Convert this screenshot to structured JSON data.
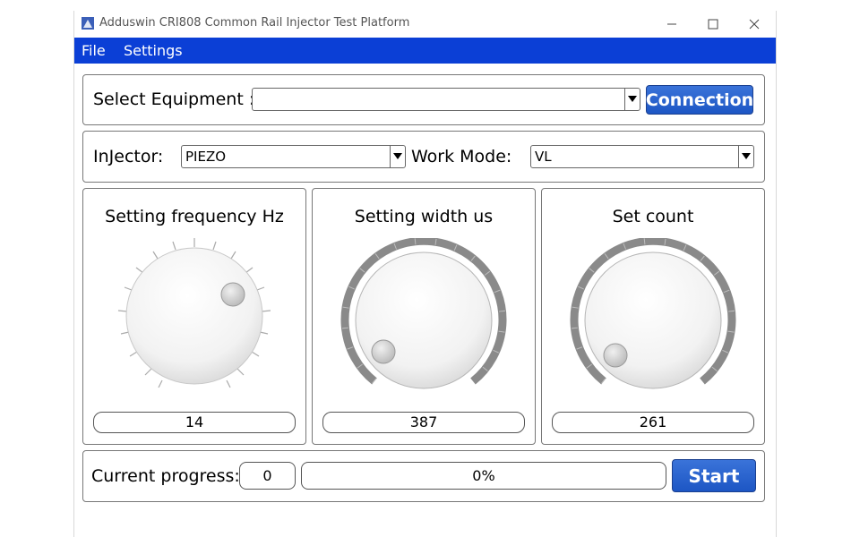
{
  "window": {
    "title": "Adduswin CRI808 Common Rail Injector Test Platform",
    "minimize_icon": "minimize-icon",
    "maximize_icon": "maximize-icon",
    "close_icon": "close-icon"
  },
  "menu": {
    "items": [
      {
        "label": "File"
      },
      {
        "label": "Settings"
      }
    ],
    "bg_color": "#0b3fd6"
  },
  "equipment": {
    "label": "Select Equipment :",
    "value": "",
    "connect_label": "Connection"
  },
  "injector": {
    "label": "InJector:",
    "value": "PIEZO",
    "work_mode_label": "Work Mode:",
    "work_mode_value": "VL"
  },
  "knobs": [
    {
      "title": "Setting frequency Hz",
      "value": "14"
    },
    {
      "title": "Setting width us",
      "value": "387"
    },
    {
      "title": "Set count",
      "value": "261"
    }
  ],
  "progress": {
    "label": "Current progress:",
    "count": "0",
    "percent": "0%",
    "percent_value": 0,
    "start_label": "Start"
  },
  "colors": {
    "accent": "#1d56c4"
  }
}
